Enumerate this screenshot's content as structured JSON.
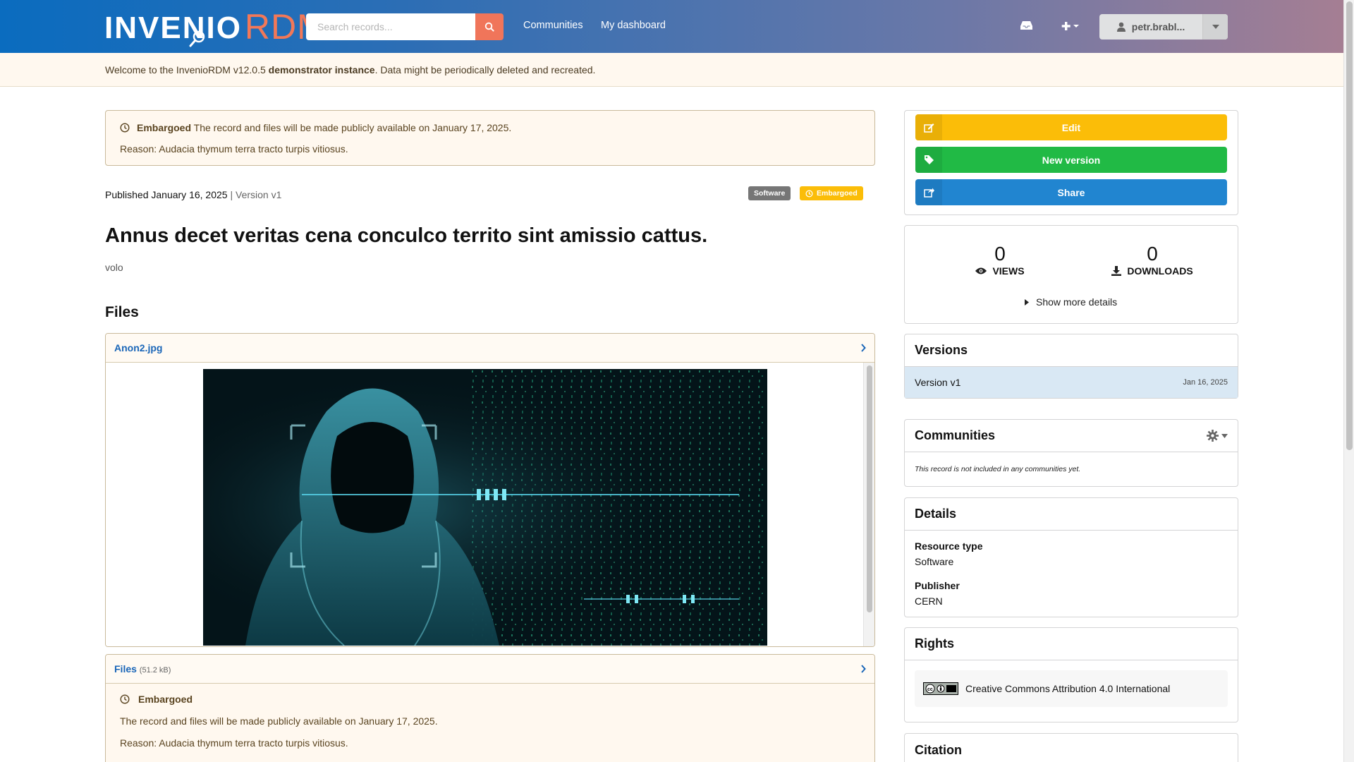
{
  "header": {
    "logo_main": "INVENIO",
    "logo_accent": "RDM",
    "search_placeholder": "Search records...",
    "nav": [
      "Communities",
      "My dashboard"
    ],
    "user_name": "petr.brabl...",
    "icons": [
      "inbox-icon",
      "plus-icon",
      "user-icon",
      "caret-down-icon"
    ]
  },
  "banner": {
    "prefix": "Welcome to the InvenioRDM v12.0.5 ",
    "bold": "demonstrator instance",
    "suffix": ". Data might be periodically deleted and recreated."
  },
  "embargo_notice": {
    "label": "Embargoed",
    "text": "The record and files will be made publicly available on January 17, 2025.",
    "reason": "Reason: Audacia thymum terra tracto turpis vitiosus."
  },
  "record": {
    "published": "Published January 16, 2025",
    "separator": "|",
    "version": "Version v1",
    "badges": {
      "type": "Software",
      "access": "Embargoed"
    },
    "title": "Annus decet veritas cena conculco territo sint amissio cattus.",
    "creator": "volo"
  },
  "files_section": {
    "heading": "Files",
    "preview_file": "Anon2.jpg",
    "list_title": "Files",
    "list_size": "(51.2 kB)",
    "embargo_title": "Embargoed",
    "embargo_text": "The record and files will be made publicly available on January 17, 2025.",
    "embargo_reason": "Reason: Audacia thymum terra tracto turpis vitiosus."
  },
  "actions": {
    "edit": "Edit",
    "new_version": "New version",
    "share": "Share"
  },
  "stats": {
    "views": "0",
    "views_label": "VIEWS",
    "downloads": "0",
    "downloads_label": "DOWNLOADS",
    "more": "Show more details"
  },
  "versions": {
    "heading": "Versions",
    "item": "Version v1",
    "date": "Jan 16, 2025"
  },
  "communities": {
    "heading": "Communities",
    "empty": "This record is not included in any communities yet."
  },
  "details": {
    "heading": "Details",
    "items": [
      {
        "key": "Resource type",
        "value": "Software"
      },
      {
        "key": "Publisher",
        "value": "CERN"
      }
    ]
  },
  "rights": {
    "heading": "Rights",
    "license": "Creative Commons Attribution 4.0 International"
  },
  "citation": {
    "heading": "Citation"
  },
  "colors": {
    "edit": "#fbbd08",
    "new_version": "#21ba45",
    "share": "#2185d0",
    "search_btn": "#f0755a",
    "version_row": "#d9e8f4"
  }
}
